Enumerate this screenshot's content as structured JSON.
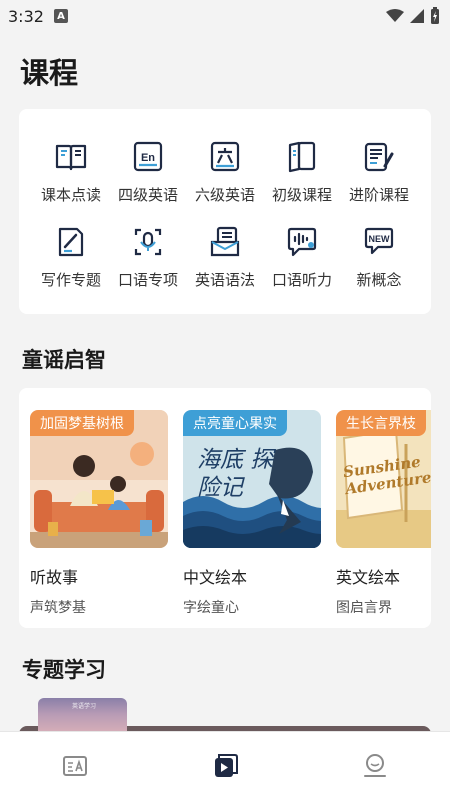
{
  "status_bar": {
    "time": "3:32",
    "notification_letter": "A",
    "icons": [
      "wifi-icon",
      "signal-icon",
      "battery-charging-icon"
    ]
  },
  "page": {
    "title": "课程"
  },
  "courses": {
    "items": [
      {
        "label": "课本点读",
        "icon": "open-book-icon"
      },
      {
        "label": "四级英语",
        "icon": "en-badge-icon"
      },
      {
        "label": "六级英语",
        "icon": "six-badge-icon"
      },
      {
        "label": "初级课程",
        "icon": "book-icon"
      },
      {
        "label": "进阶课程",
        "icon": "notes-pen-icon"
      },
      {
        "label": "写作专题",
        "icon": "writing-icon"
      },
      {
        "label": "口语专项",
        "icon": "microphone-icon"
      },
      {
        "label": "英语语法",
        "icon": "document-stack-icon"
      },
      {
        "label": "口语听力",
        "icon": "voice-chat-icon"
      },
      {
        "label": "新概念",
        "icon": "new-badge-icon"
      }
    ]
  },
  "rhymes": {
    "title": "童谣启智",
    "books": [
      {
        "tag": "加固梦基树根",
        "title": "听故事",
        "subtitle": "声筑梦基",
        "tag_color": "#f0924a"
      },
      {
        "tag": "点亮童心果实",
        "title": "中文绘本",
        "subtitle": "字绘童心",
        "tag_color": "#3e9fd6",
        "cover_text": "海底 探险记"
      },
      {
        "tag": "生长言界枝",
        "title": "英文绘本",
        "subtitle": "图启言界",
        "tag_color": "#f0924a",
        "cover_text": "Sunshine Adventures"
      }
    ]
  },
  "special": {
    "title": "专题学习",
    "thumb_text": "英语学习"
  },
  "bottom_nav": {
    "items": [
      {
        "icon": "translate-card-icon",
        "active": false
      },
      {
        "icon": "video-play-icon",
        "active": true
      },
      {
        "icon": "profile-icon",
        "active": false
      }
    ]
  },
  "colors": {
    "accent": "#1f2a44",
    "orange": "#f0924a",
    "blue": "#3e9fd6",
    "background": "#f3f3f3"
  }
}
